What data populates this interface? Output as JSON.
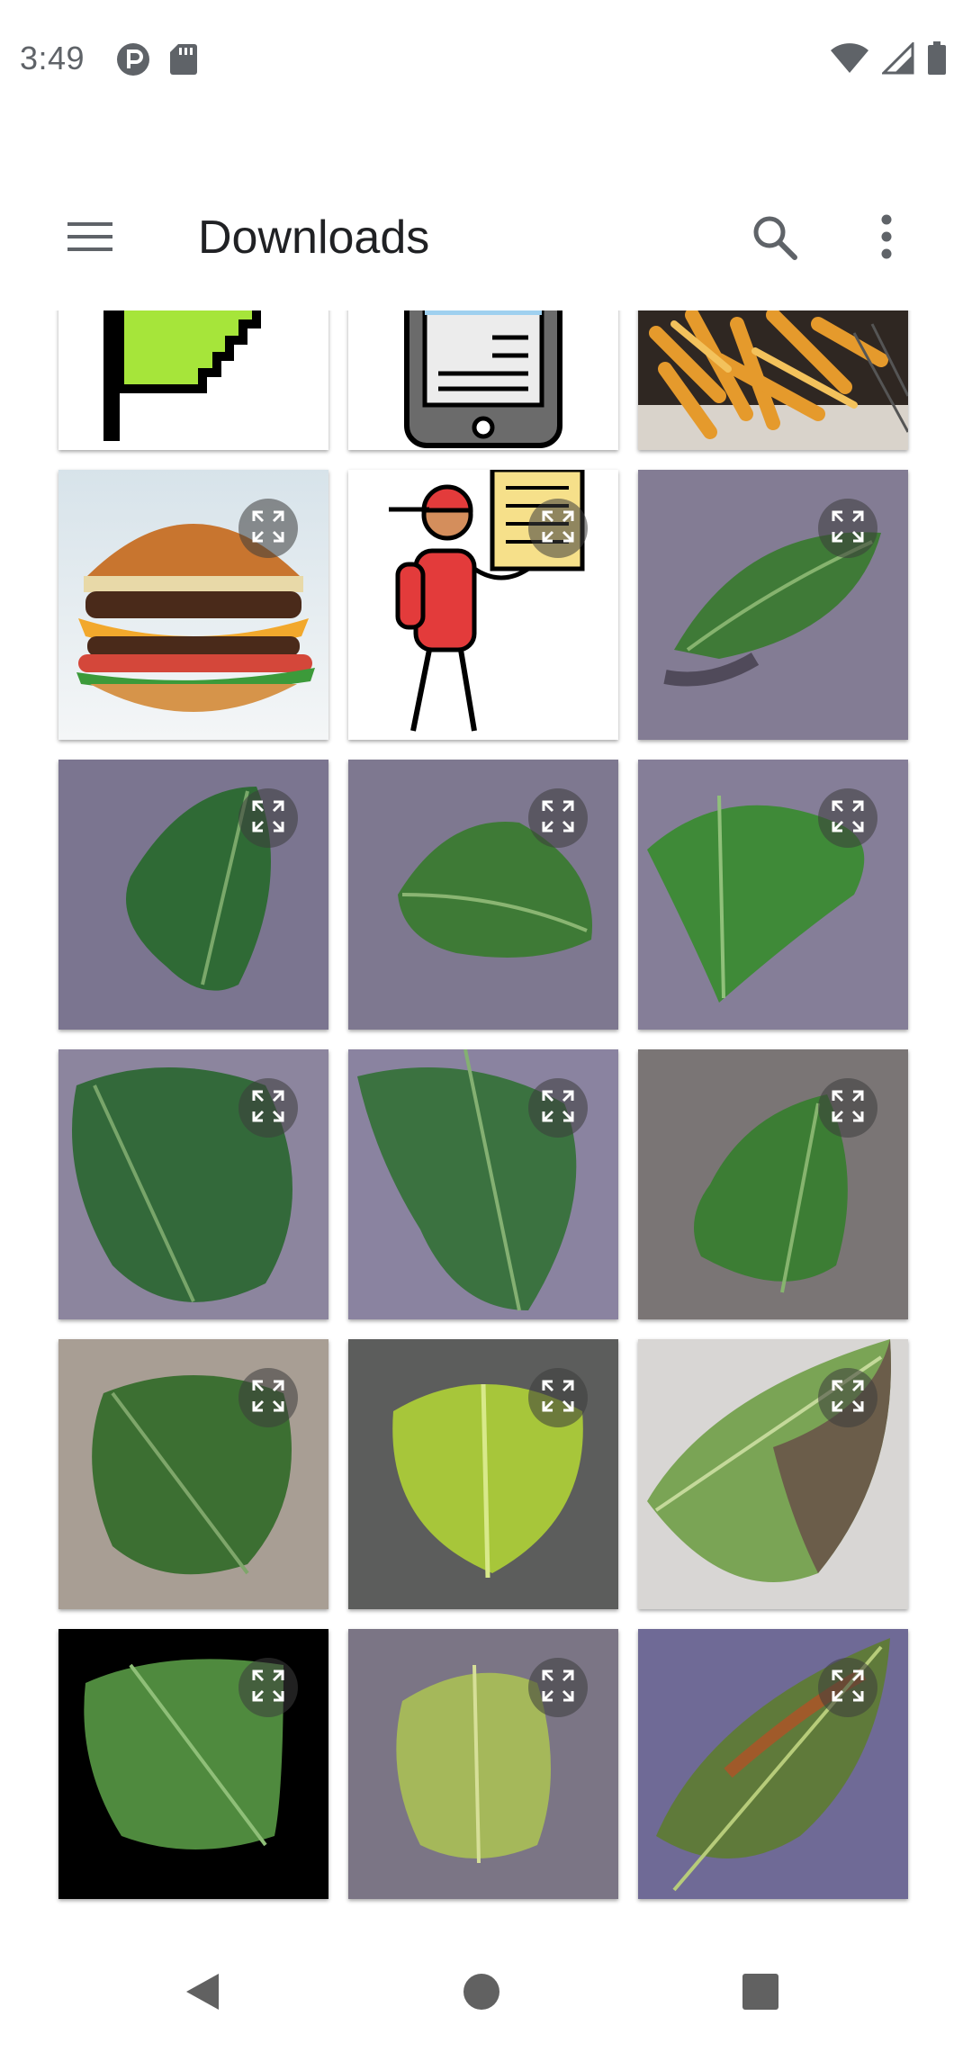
{
  "status_bar": {
    "time": "3:49",
    "left_icons": [
      "notification-p-icon",
      "sd-card-icon"
    ],
    "right_icons": [
      "wifi-icon",
      "signal-icon",
      "battery-icon"
    ]
  },
  "app_bar": {
    "title": "Downloads",
    "menu_icon": "menu-icon",
    "search_icon": "search-icon",
    "more_icon": "more-vert-icon"
  },
  "grid": {
    "columns": 3,
    "items": [
      {
        "subject": "flag",
        "has_expand_badge": false
      },
      {
        "subject": "phone",
        "has_expand_badge": false
      },
      {
        "subject": "fries",
        "has_expand_badge": false
      },
      {
        "subject": "burger",
        "has_expand_badge": true
      },
      {
        "subject": "delivery-person",
        "has_expand_badge": true
      },
      {
        "subject": "leaf",
        "has_expand_badge": true
      },
      {
        "subject": "leaf",
        "has_expand_badge": true
      },
      {
        "subject": "leaf",
        "has_expand_badge": true
      },
      {
        "subject": "leaf",
        "has_expand_badge": true
      },
      {
        "subject": "leaf",
        "has_expand_badge": true
      },
      {
        "subject": "leaf",
        "has_expand_badge": true
      },
      {
        "subject": "leaf",
        "has_expand_badge": true
      },
      {
        "subject": "leaf",
        "has_expand_badge": true
      },
      {
        "subject": "leaf-yellow",
        "has_expand_badge": true
      },
      {
        "subject": "leaf-diseased",
        "has_expand_badge": true
      },
      {
        "subject": "leaf-black-background",
        "has_expand_badge": true
      },
      {
        "subject": "leaf-yellow-green",
        "has_expand_badge": true
      },
      {
        "subject": "leaf-brown-spotted",
        "has_expand_badge": true
      }
    ]
  },
  "nav_bar": {
    "back_icon": "back-icon",
    "home_icon": "home-icon",
    "recents_icon": "recents-icon"
  },
  "colors": {
    "status_text": "#5f6368",
    "title_text": "#202124",
    "icon_gray": "#5f6368",
    "badge_bg": "#3c3c3c"
  }
}
